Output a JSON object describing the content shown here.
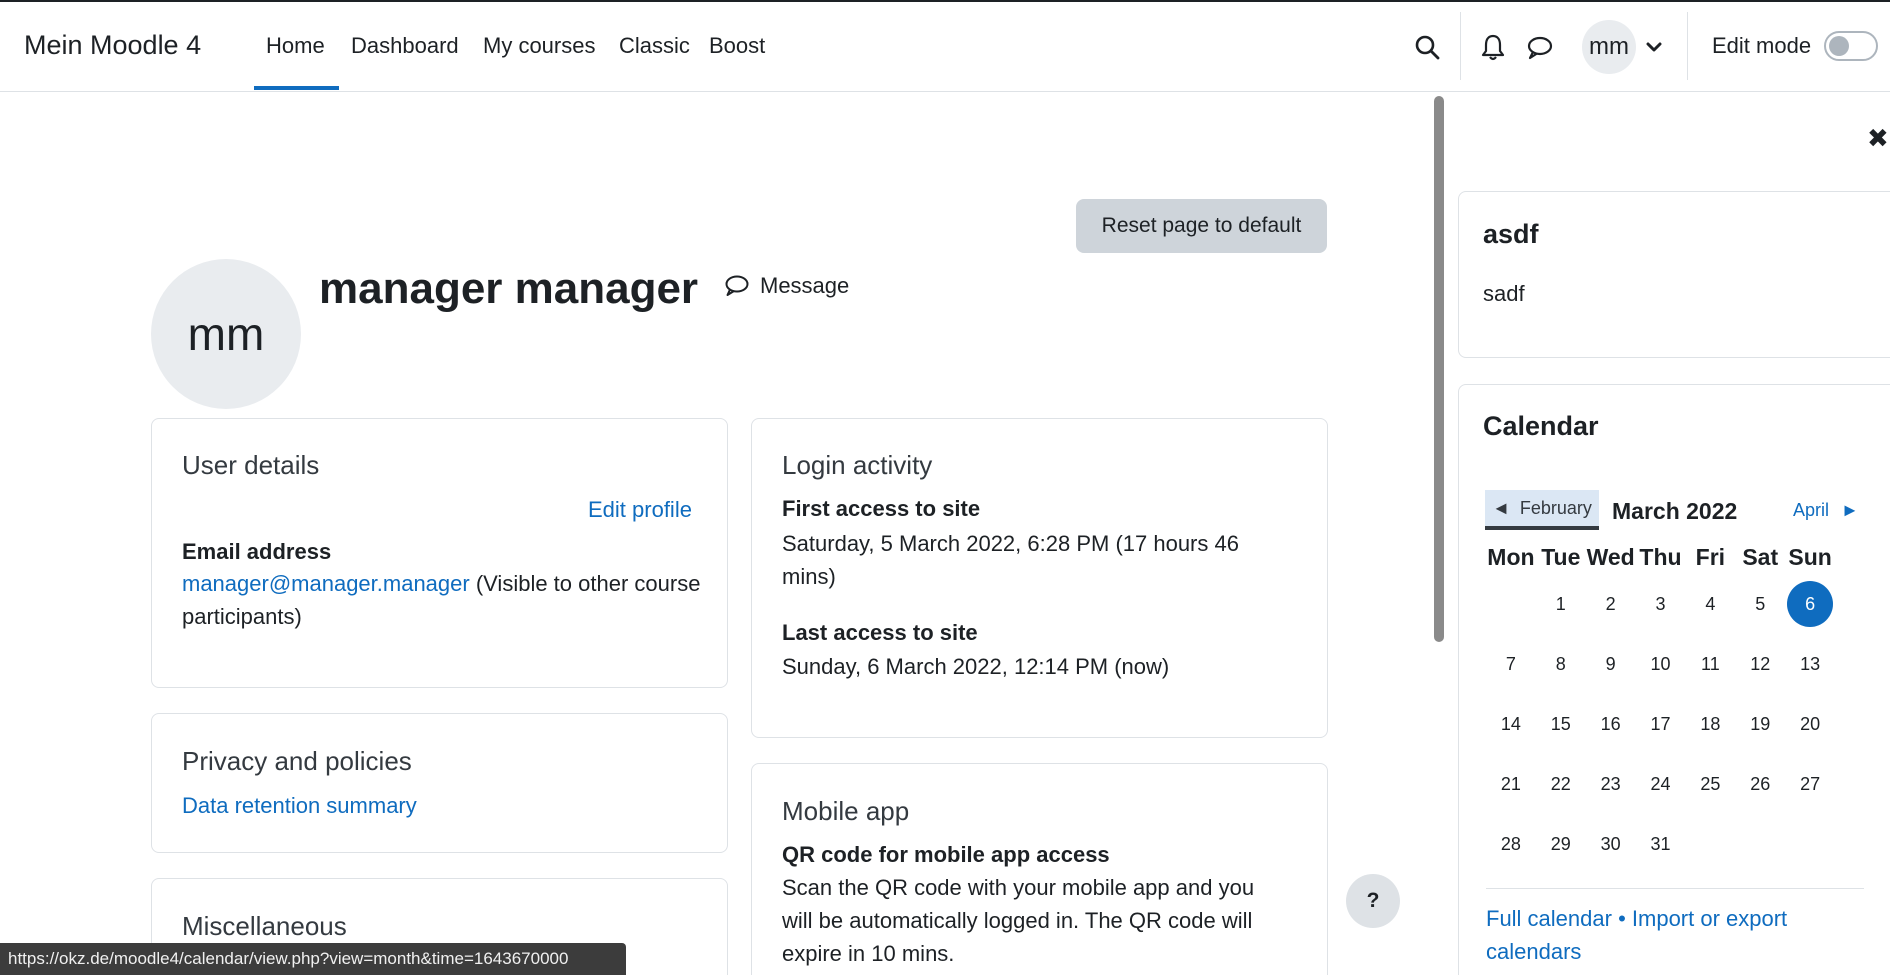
{
  "brand": "Mein Moodle 4",
  "nav": {
    "items": [
      {
        "label": "Home"
      },
      {
        "label": "Dashboard"
      },
      {
        "label": "My courses"
      },
      {
        "label": "Classic"
      },
      {
        "label": "Boost"
      }
    ],
    "active": "Home"
  },
  "user_menu": {
    "initials": "mm"
  },
  "edit_mode": {
    "label": "Edit mode",
    "enabled": false
  },
  "reset_button": "Reset page to default",
  "profile": {
    "initials": "mm",
    "name": "manager manager",
    "message_label": "Message"
  },
  "user_details": {
    "title": "User details",
    "edit_profile": "Edit profile",
    "email_label": "Email address",
    "email": "manager@manager.manager",
    "email_note": " (Visible to other course participants)"
  },
  "privacy": {
    "title": "Privacy and policies",
    "link": "Data retention summary"
  },
  "misc": {
    "title": "Miscellaneous"
  },
  "login_activity": {
    "title": "Login activity",
    "first_label": "First access to site",
    "first_value": "Saturday, 5 March 2022, 6:28 PM  (17 hours 46 mins)",
    "last_label": "Last access to site",
    "last_value": "Sunday, 6 March 2022, 12:14 PM  (now)"
  },
  "mobile_app": {
    "title": "Mobile app",
    "qr_label": "QR code for mobile app access",
    "qr_text": "Scan the QR code with your mobile app and you will be automatically logged in. The QR code will expire in 10 mins."
  },
  "help_button": "?",
  "drawer": {
    "text_block": {
      "title": "asdf",
      "content": "sadf"
    },
    "calendar": {
      "title": "Calendar",
      "prev": "February",
      "month": "March 2022",
      "next": "April",
      "weekdays": [
        "Mon",
        "Tue",
        "Wed",
        "Thu",
        "Fri",
        "Sat",
        "Sun"
      ],
      "weeks": [
        [
          "",
          "1",
          "2",
          "3",
          "4",
          "5",
          "6"
        ],
        [
          "7",
          "8",
          "9",
          "10",
          "11",
          "12",
          "13"
        ],
        [
          "14",
          "15",
          "16",
          "17",
          "18",
          "19",
          "20"
        ],
        [
          "21",
          "22",
          "23",
          "24",
          "25",
          "26",
          "27"
        ],
        [
          "28",
          "29",
          "30",
          "31",
          "",
          "",
          ""
        ]
      ],
      "today": "6",
      "footer_full": "Full calendar",
      "footer_sep": " • ",
      "footer_import": "Import or export calendars"
    }
  },
  "status_url": "https://okz.de/moodle4/calendar/view.php?view=month&time=1643670000",
  "colors": {
    "accent": "#0f6cbf",
    "text": "#1d2125"
  }
}
